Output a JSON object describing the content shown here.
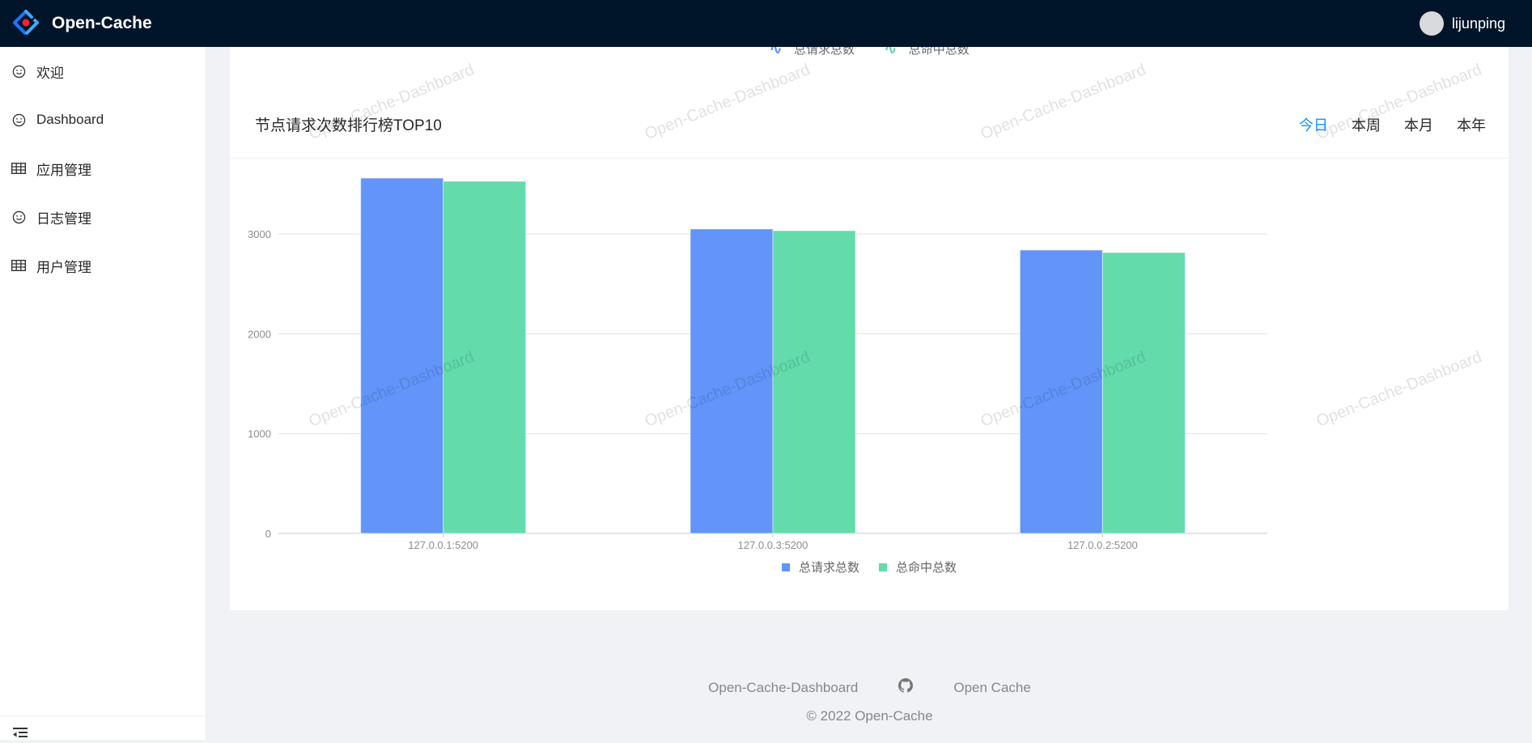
{
  "header": {
    "app_title": "Open-Cache",
    "username": "lijunping"
  },
  "sidebar": {
    "items": [
      {
        "label": "欢迎",
        "icon": "smile-icon"
      },
      {
        "label": "Dashboard",
        "icon": "smile-icon"
      },
      {
        "label": "应用管理",
        "icon": "table-icon"
      },
      {
        "label": "日志管理",
        "icon": "smile-icon"
      },
      {
        "label": "用户管理",
        "icon": "table-icon"
      }
    ],
    "collapse_icon": "menu-fold-icon"
  },
  "previous_chart_legend": [
    {
      "label": "总请求总数",
      "color": "#5b8ff9"
    },
    {
      "label": "总命中总数",
      "color": "#5ad8a6"
    }
  ],
  "card": {
    "title": "节点请求次数排行榜TOP10",
    "range_tabs": [
      {
        "label": "今日",
        "active": true
      },
      {
        "label": "本周",
        "active": false
      },
      {
        "label": "本月",
        "active": false
      },
      {
        "label": "本年",
        "active": false
      }
    ]
  },
  "watermark_text": "Open-Cache-Dashboard",
  "colors": {
    "accent": "#1890ff",
    "header_bg": "#001529",
    "series_blue": "#6294f9",
    "series_green": "#63dbab"
  },
  "chart_data": {
    "type": "bar",
    "title": "节点请求次数排行榜TOP10",
    "xlabel": "",
    "ylabel": "",
    "categories": [
      "127.0.0.1:5200",
      "127.0.0.3:5200",
      "127.0.0.2:5200"
    ],
    "series": [
      {
        "name": "总请求总数",
        "color": "#6294f9",
        "values": [
          3560,
          3050,
          2839
        ]
      },
      {
        "name": "总命中总数",
        "color": "#63dbab",
        "values": [
          3528,
          3033,
          2814
        ]
      }
    ],
    "yticks": [
      0,
      1000,
      2000,
      3000
    ],
    "ylim": [
      0,
      3600
    ],
    "grid": true,
    "legend_position": "bottom-center"
  },
  "footer": {
    "link_left": "Open-Cache-Dashboard",
    "link_right": "Open Cache",
    "github_icon": "github-icon",
    "copyright": "© 2022 Open-Cache"
  }
}
